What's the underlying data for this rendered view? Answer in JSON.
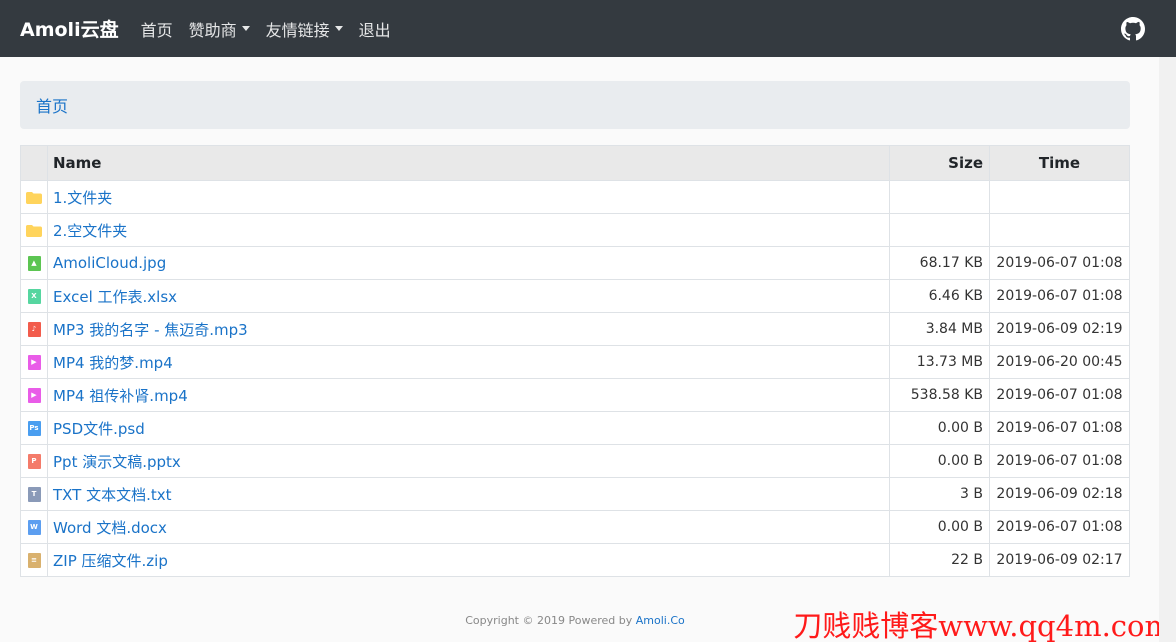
{
  "navbar": {
    "brand": "Amoli云盘",
    "items": [
      {
        "label": "首页",
        "dropdown": false
      },
      {
        "label": "赞助商",
        "dropdown": true
      },
      {
        "label": "友情链接",
        "dropdown": true
      },
      {
        "label": "退出",
        "dropdown": false
      }
    ],
    "github_icon": "github-icon"
  },
  "breadcrumb": {
    "home": "首页"
  },
  "table": {
    "headers": {
      "name": "Name",
      "size": "Size",
      "time": "Time"
    },
    "rows": [
      {
        "icon": "folder",
        "color": "#ffd45c",
        "name": "1.文件夹",
        "size": "",
        "time": ""
      },
      {
        "icon": "folder",
        "color": "#ffd45c",
        "name": "2.空文件夹",
        "size": "",
        "time": ""
      },
      {
        "icon": "image",
        "color": "#5cc552",
        "name": "AmoliCloud.jpg",
        "size": "68.17 KB",
        "time": "2019-06-07 01:08"
      },
      {
        "icon": "excel",
        "color": "#56d6a0",
        "name": "Excel 工作表.xlsx",
        "size": "6.46 KB",
        "time": "2019-06-07 01:08"
      },
      {
        "icon": "audio",
        "color": "#f25c4c",
        "name": "MP3 我的名字 - 焦迈奇.mp3",
        "size": "3.84 MB",
        "time": "2019-06-09 02:19"
      },
      {
        "icon": "video",
        "color": "#e95ce8",
        "name": "MP4 我的梦.mp4",
        "size": "13.73 MB",
        "time": "2019-06-20 00:45"
      },
      {
        "icon": "video",
        "color": "#e95ce8",
        "name": "MP4 祖传补肾.mp4",
        "size": "538.58 KB",
        "time": "2019-06-07 01:08"
      },
      {
        "icon": "psd",
        "color": "#4a9ef0",
        "name": "PSD文件.psd",
        "size": "0.00 B",
        "time": "2019-06-07 01:08"
      },
      {
        "icon": "ppt",
        "color": "#f47b6a",
        "name": "Ppt 演示文稿.pptx",
        "size": "0.00 B",
        "time": "2019-06-07 01:08"
      },
      {
        "icon": "txt",
        "color": "#8a9ab8",
        "name": "TXT 文本文档.txt",
        "size": "3 B",
        "time": "2019-06-09 02:18"
      },
      {
        "icon": "word",
        "color": "#5c9ef0",
        "name": "Word 文档.docx",
        "size": "0.00 B",
        "time": "2019-06-07 01:08"
      },
      {
        "icon": "zip",
        "color": "#d9b16e",
        "name": "ZIP 压缩文件.zip",
        "size": "22 B",
        "time": "2019-06-09 02:17"
      }
    ]
  },
  "footer": {
    "text": "Copyright © 2019 Powered by ",
    "link": "Amoli.Co"
  },
  "watermark": "刀贱贱博客www.qq4m.com"
}
